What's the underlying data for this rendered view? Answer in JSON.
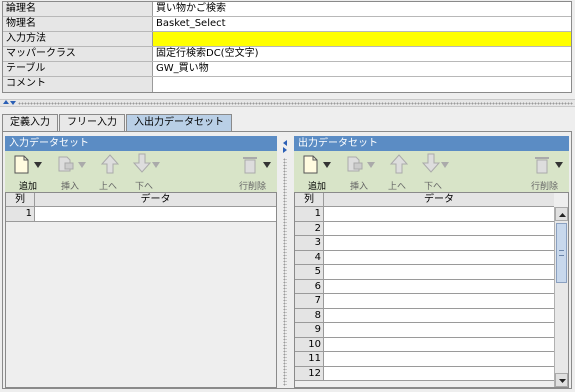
{
  "properties": [
    {
      "label": "論理名",
      "value": "買い物かご検索"
    },
    {
      "label": "物理名",
      "value": "Basket_Select"
    },
    {
      "label": "入力方法",
      "value": ""
    },
    {
      "label": "マッパークラス",
      "value": "固定行検索DC(空文字)"
    },
    {
      "label": "テーブル",
      "value": "GW_買い物"
    },
    {
      "label": "コメント",
      "value": ""
    }
  ],
  "tabs": [
    {
      "label": "定義入力",
      "active": false
    },
    {
      "label": "フリー入力",
      "active": false
    },
    {
      "label": "入出力データセット",
      "active": true
    }
  ],
  "colors": {
    "highlight": "#ffff00",
    "panel_title": "#5b8cc4",
    "active_tab": "#b9cfe6",
    "toolbar": "#d8e4c8"
  },
  "toolbar": {
    "add": "追加",
    "insert": "挿入",
    "up": "上へ",
    "down": "下へ",
    "delete_row": "行削除"
  },
  "input_panel": {
    "title": "入力データセット",
    "col_header": "列",
    "data_header": "データ",
    "rows": [
      "1"
    ]
  },
  "output_panel": {
    "title": "出力データセット",
    "col_header": "列",
    "data_header": "データ",
    "rows": [
      "1",
      "2",
      "3",
      "4",
      "5",
      "6",
      "7",
      "8",
      "9",
      "10",
      "11",
      "12"
    ]
  }
}
